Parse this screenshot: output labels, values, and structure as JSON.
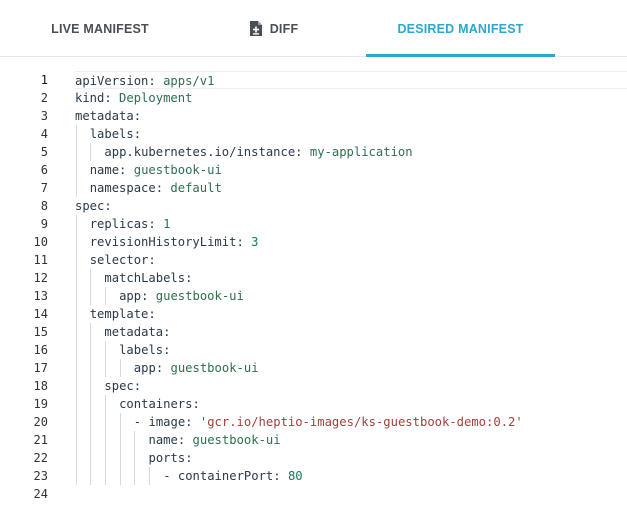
{
  "tabs": {
    "live_label": "LIVE MANIFEST",
    "diff_label": "DIFF",
    "desired_label": "DESIRED MANIFEST",
    "active": "desired",
    "diff_icon": "file-diff-icon"
  },
  "colors": {
    "accent": "#2ba8ce",
    "key": "#2a3a4a",
    "value": "#2f6f4f",
    "string": "#a3403a",
    "number": "#0f7a5c"
  },
  "editor": {
    "current_line": 1,
    "lines": [
      {
        "n": "1",
        "indent": 0,
        "key": "apiVersion",
        "val": "apps/v1",
        "type": "v"
      },
      {
        "n": "2",
        "indent": 0,
        "key": "kind",
        "val": "Deployment",
        "type": "v"
      },
      {
        "n": "3",
        "indent": 0,
        "key": "metadata",
        "val": "",
        "type": "v"
      },
      {
        "n": "4",
        "indent": 1,
        "key": "labels",
        "val": "",
        "type": "v"
      },
      {
        "n": "5",
        "indent": 2,
        "key": "app.kubernetes.io/instance",
        "val": "my-application",
        "type": "v"
      },
      {
        "n": "6",
        "indent": 1,
        "key": "name",
        "val": "guestbook-ui",
        "type": "v"
      },
      {
        "n": "7",
        "indent": 1,
        "key": "namespace",
        "val": "default",
        "type": "v"
      },
      {
        "n": "8",
        "indent": 0,
        "key": "spec",
        "val": "",
        "type": "v"
      },
      {
        "n": "9",
        "indent": 1,
        "key": "replicas",
        "val": "1",
        "type": "n"
      },
      {
        "n": "10",
        "indent": 1,
        "key": "revisionHistoryLimit",
        "val": "3",
        "type": "n"
      },
      {
        "n": "11",
        "indent": 1,
        "key": "selector",
        "val": "",
        "type": "v"
      },
      {
        "n": "12",
        "indent": 2,
        "key": "matchLabels",
        "val": "",
        "type": "v"
      },
      {
        "n": "13",
        "indent": 3,
        "key": "app",
        "val": "guestbook-ui",
        "type": "v"
      },
      {
        "n": "14",
        "indent": 1,
        "key": "template",
        "val": "",
        "type": "v"
      },
      {
        "n": "15",
        "indent": 2,
        "key": "metadata",
        "val": "",
        "type": "v"
      },
      {
        "n": "16",
        "indent": 3,
        "key": "labels",
        "val": "",
        "type": "v"
      },
      {
        "n": "17",
        "indent": 4,
        "key": "app",
        "val": "guestbook-ui",
        "type": "v"
      },
      {
        "n": "18",
        "indent": 2,
        "key": "spec",
        "val": "",
        "type": "v"
      },
      {
        "n": "19",
        "indent": 3,
        "key": "containers",
        "val": "",
        "type": "v"
      },
      {
        "n": "20",
        "indent": 4,
        "dash": true,
        "key": "image",
        "val": "'gcr.io/heptio-images/ks-guestbook-demo:0.2'",
        "type": "s"
      },
      {
        "n": "21",
        "indent": 5,
        "key": "name",
        "val": "guestbook-ui",
        "type": "v"
      },
      {
        "n": "22",
        "indent": 5,
        "key": "ports",
        "val": "",
        "type": "v"
      },
      {
        "n": "23",
        "indent": 6,
        "dash": true,
        "key": "containerPort",
        "val": "80",
        "type": "n"
      },
      {
        "n": "24",
        "indent": 0,
        "key": "",
        "val": "",
        "type": "v"
      }
    ]
  }
}
